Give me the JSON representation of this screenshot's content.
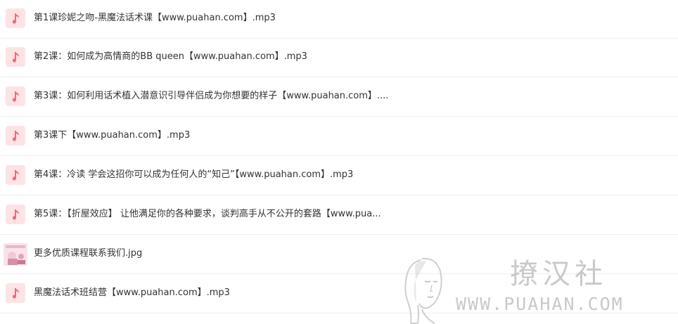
{
  "files": [
    {
      "name": "第1课珍妮之吻-黑魔法话术课【www.puahan.com】.mp3",
      "icon": "music-icon"
    },
    {
      "name": "第2课：如何成为高情商的BB queen【www.puahan.com】.mp3",
      "icon": "music-icon"
    },
    {
      "name": "第3课：如何利用话术植入潜意识引导伴侣成为你想要的样子【www.puahan.com】....",
      "icon": "music-icon"
    },
    {
      "name": "第3课下【www.puahan.com】.mp3",
      "icon": "music-icon"
    },
    {
      "name": "第4课：冷读 学会这招你可以成为任何人的“知己”【www.puahan.com】.mp3",
      "icon": "music-icon"
    },
    {
      "name": "第5课：【折屋效应】 让他满足你的各种要求，谈判高手从不公开的套路【www.pua...",
      "icon": "music-icon"
    },
    {
      "name": "更多优质课程联系我们.jpg",
      "icon": "image-thumbnail"
    },
    {
      "name": "黑魔法话术班结营【www.puahan.com】.mp3",
      "icon": "music-icon"
    }
  ],
  "watermark": {
    "title": "撩汉社",
    "url": "WWW.PUAHAN.COM"
  },
  "colors": {
    "icon_bg": "#fde3e6",
    "icon_fg": "#f06a7a",
    "text": "#333333",
    "divider": "#eeeeee",
    "watermark": "#c9c9c9"
  }
}
